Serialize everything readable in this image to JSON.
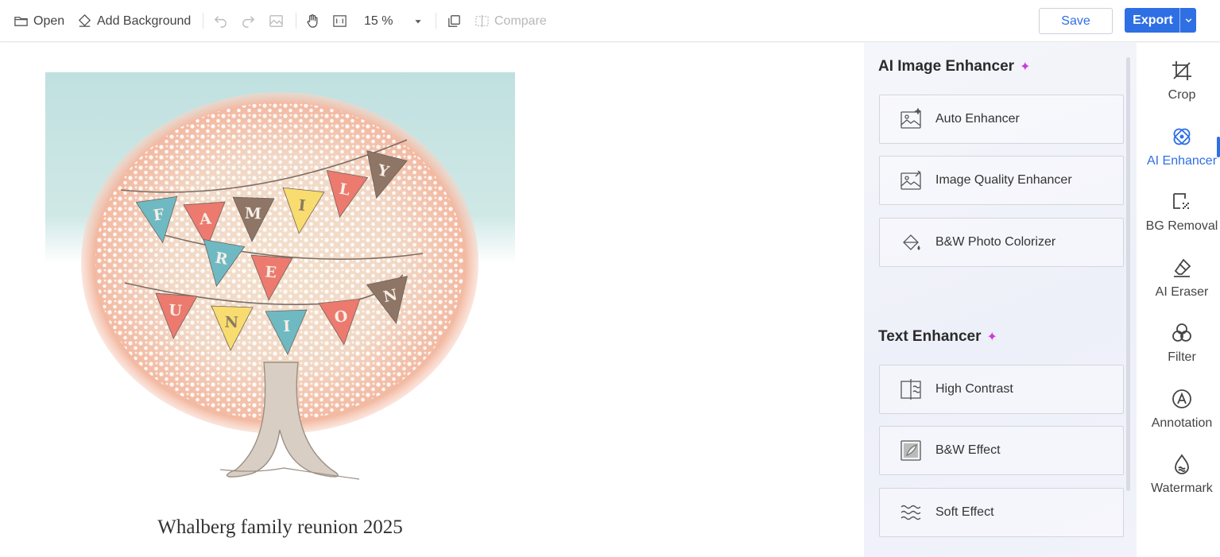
{
  "toolbar": {
    "open_label": "Open",
    "add_background_label": "Add Background",
    "zoom_value": "15 %",
    "compare_label": "Compare",
    "save_label": "Save",
    "export_label": "Export"
  },
  "canvas": {
    "caption": "Whalberg family reunion 2025",
    "banner_letters_row1": [
      "F",
      "A",
      "M",
      "I",
      "L",
      "Y"
    ],
    "banner_letters_row2": [
      "R",
      "E",
      "U",
      "N",
      "I",
      "O",
      "N"
    ]
  },
  "panel": {
    "ai_image_enhancer": {
      "title": "AI Image Enhancer",
      "items": [
        {
          "label": "Auto Enhancer",
          "icon": "auto-enhancer-icon"
        },
        {
          "label": "Image Quality Enhancer",
          "icon": "image-quality-icon"
        },
        {
          "label": "B&W Photo Colorizer",
          "icon": "paint-bucket-icon"
        }
      ]
    },
    "text_enhancer": {
      "title": "Text Enhancer",
      "items": [
        {
          "label": "High Contrast",
          "icon": "high-contrast-icon"
        },
        {
          "label": "B&W Effect",
          "icon": "bw-effect-icon"
        },
        {
          "label": "Soft Effect",
          "icon": "soft-effect-icon"
        }
      ]
    }
  },
  "tools": [
    {
      "label": "Crop",
      "icon": "crop-icon"
    },
    {
      "label": "AI Enhancer",
      "icon": "ai-enhancer-icon",
      "active": true
    },
    {
      "label": "BG Removal",
      "icon": "bg-removal-icon"
    },
    {
      "label": "AI Eraser",
      "icon": "eraser-icon"
    },
    {
      "label": "Filter",
      "icon": "filter-icon"
    },
    {
      "label": "Annotation",
      "icon": "annotation-icon"
    },
    {
      "label": "Watermark",
      "icon": "watermark-icon"
    }
  ],
  "colors": {
    "accent": "#2f6fe4",
    "sparkle": "#c93dd6",
    "sky": "#c2e1e0",
    "pennant_teal": "#6fb9c2",
    "pennant_coral": "#ec7a6f",
    "pennant_brown": "#8e7566",
    "pennant_yellow": "#f8dc6f"
  }
}
